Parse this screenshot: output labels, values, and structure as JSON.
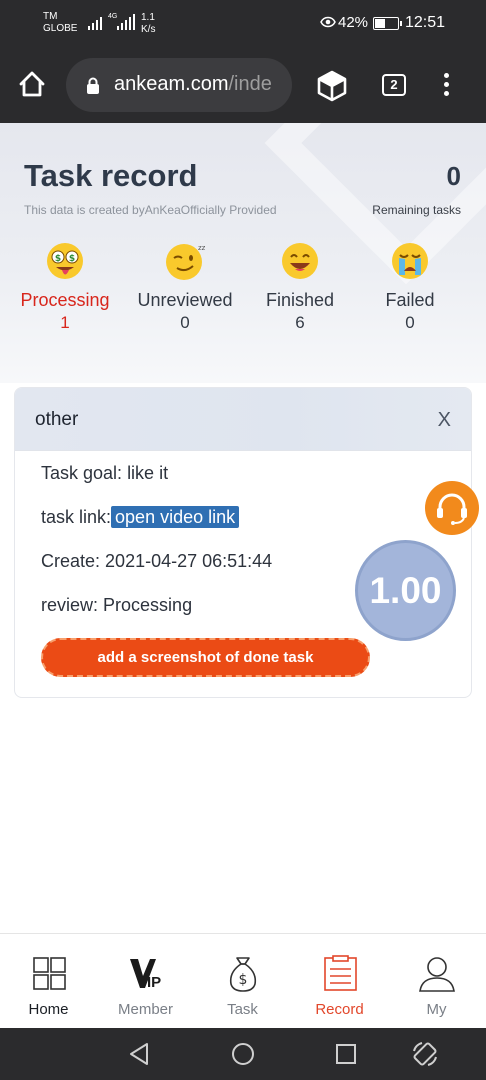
{
  "status_bar": {
    "carrier_line1": "TM",
    "carrier_line2": "GLOBE",
    "network": "4G",
    "speed_value": "1.1",
    "speed_unit": "K/s",
    "battery": "42%",
    "time": "12:51"
  },
  "browser": {
    "url_domain": "ankeam.com",
    "url_path": "/inde",
    "tab_count": "2"
  },
  "header": {
    "title": "Task record",
    "subtitle": "This data is created byAnKeaOfficially Provided",
    "remaining_count": "0",
    "remaining_label": "Remaining tasks"
  },
  "stats": [
    {
      "label": "Processing",
      "count": "1",
      "icon": "money-eyes-face-icon"
    },
    {
      "label": "Unreviewed",
      "count": "0",
      "icon": "winking-face-icon"
    },
    {
      "label": "Finished",
      "count": "6",
      "icon": "grinning-face-icon"
    },
    {
      "label": "Failed",
      "count": "0",
      "icon": "crying-face-icon"
    }
  ],
  "task_card": {
    "title": "other",
    "close_label": "X",
    "goal_label": "Task goal:",
    "goal_value": "like it",
    "link_label": "task link:",
    "link_text": "open video link",
    "create_label": "Create:",
    "create_value": "2021-04-27 06:51:44",
    "review_label": "review:",
    "review_value": "Processing",
    "button_label": "add a screenshot of done task"
  },
  "balance_badge": "1.00",
  "bottom_nav": [
    {
      "label": "Home",
      "icon": "grid-icon"
    },
    {
      "label": "Member",
      "icon": "vip-icon"
    },
    {
      "label": "Task",
      "icon": "money-bag-icon"
    },
    {
      "label": "Record",
      "icon": "clipboard-icon"
    },
    {
      "label": "My",
      "icon": "user-icon"
    }
  ],
  "colors": {
    "accent_red": "#d8261c",
    "button_orange": "#eb4b15",
    "record_active": "#e2472b",
    "link_blue": "#2f6fb3",
    "support_orange": "#f28a1c",
    "balance_blue": "#a3b5da"
  }
}
